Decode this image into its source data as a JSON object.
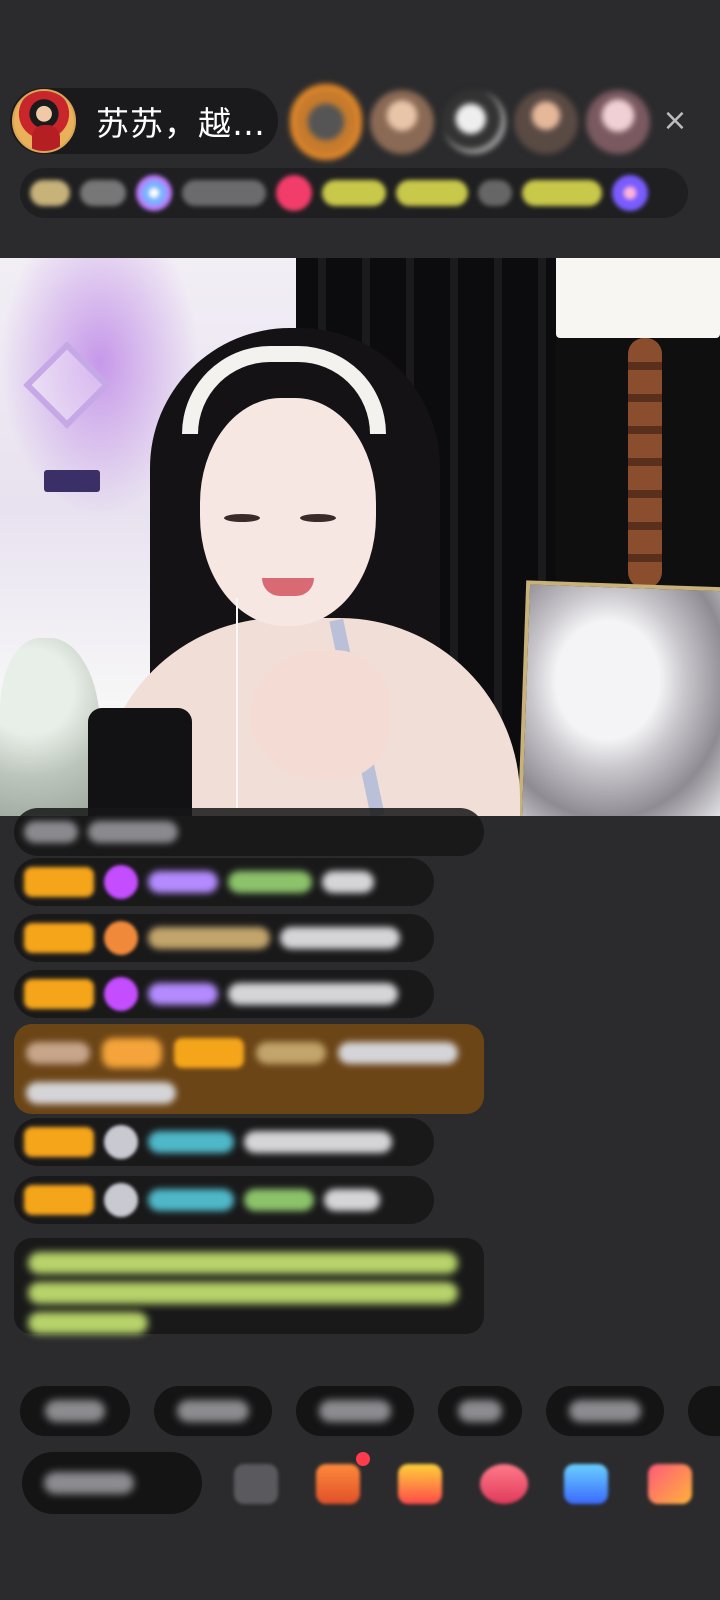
{
  "host": {
    "name": "苏苏，越…",
    "avatar_desc": "host-avatar"
  },
  "header": {
    "close_icon": "×",
    "viewers": [
      "viewer-1",
      "viewer-2",
      "viewer-3",
      "viewer-4",
      "viewer-5"
    ]
  },
  "badge_strip": {
    "items": [
      "level-badge",
      "fan-badge",
      "hot-badge",
      "rank-badge",
      "gift-badge"
    ]
  },
  "video": {
    "label": "live-stream-video"
  },
  "chat": {
    "messages": [
      {
        "kind": "text-only"
      },
      {
        "kind": "level+gem+name+text"
      },
      {
        "kind": "level+gem+name+text"
      },
      {
        "kind": "level+gem+name+text"
      },
      {
        "kind": "gift-banner"
      },
      {
        "kind": "level+gem+name+text"
      },
      {
        "kind": "level+gem+name+text"
      },
      {
        "kind": "system-notice"
      }
    ]
  },
  "quick_chips": {
    "count": 6
  },
  "bottom_bar": {
    "icons": [
      "emoji-icon",
      "gift-box-icon",
      "treasure-icon",
      "heart-icon",
      "game-icon",
      "grid-icon"
    ]
  },
  "colors": {
    "background": "#2b2b2d",
    "level_badge": "#f5a51a",
    "system_text": "#b7d36a",
    "gift_banner": "#784a14",
    "notification_dot": "#ff3b4e"
  }
}
